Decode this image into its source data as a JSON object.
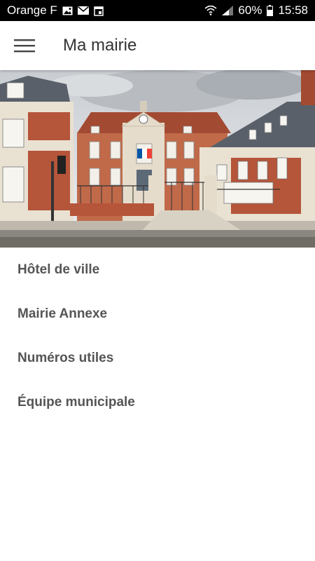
{
  "status_bar": {
    "carrier": "Orange F",
    "battery": "60%",
    "time": "15:58",
    "icons": [
      "image-icon",
      "mail-icon",
      "calendar-icon",
      "wifi-icon",
      "signal-icon",
      "battery-icon"
    ]
  },
  "app_bar": {
    "menu_icon": "hamburger-menu-icon",
    "title": "Ma mairie"
  },
  "hero": {
    "image": "town-hall-photo"
  },
  "menu": {
    "items": [
      {
        "label": "Hôtel de ville"
      },
      {
        "label": "Mairie Annexe"
      },
      {
        "label": "Numéros utiles"
      },
      {
        "label": "Équipe municipale"
      }
    ]
  },
  "colors": {
    "status_bar_bg": "#000000",
    "app_bar_bg": "#ffffff",
    "title_text": "#333333",
    "menu_text": "#555555",
    "brick": "#b5553a",
    "stone": "#e8e0d2",
    "roof": "#5a6068"
  }
}
